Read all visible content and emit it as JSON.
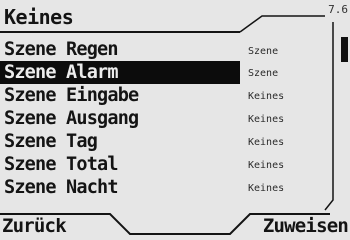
{
  "header": {
    "title": "Keines",
    "version": "7.6"
  },
  "scenes": [
    {
      "name": "Szene Regen",
      "assignment": "Szene",
      "selected": false
    },
    {
      "name": "Szene Alarm",
      "assignment": "Szene",
      "selected": true
    },
    {
      "name": "Szene Eingabe",
      "assignment": "Keines",
      "selected": false
    },
    {
      "name": "Szene Ausgang",
      "assignment": "Keines",
      "selected": false
    },
    {
      "name": "Szene Tag",
      "assignment": "Keines",
      "selected": false
    },
    {
      "name": "Szene Total",
      "assignment": "Keines",
      "selected": false
    },
    {
      "name": "Szene Nacht",
      "assignment": "Keines",
      "selected": false
    }
  ],
  "softkeys": {
    "left": "Zurück",
    "right": "Zuweisen"
  }
}
